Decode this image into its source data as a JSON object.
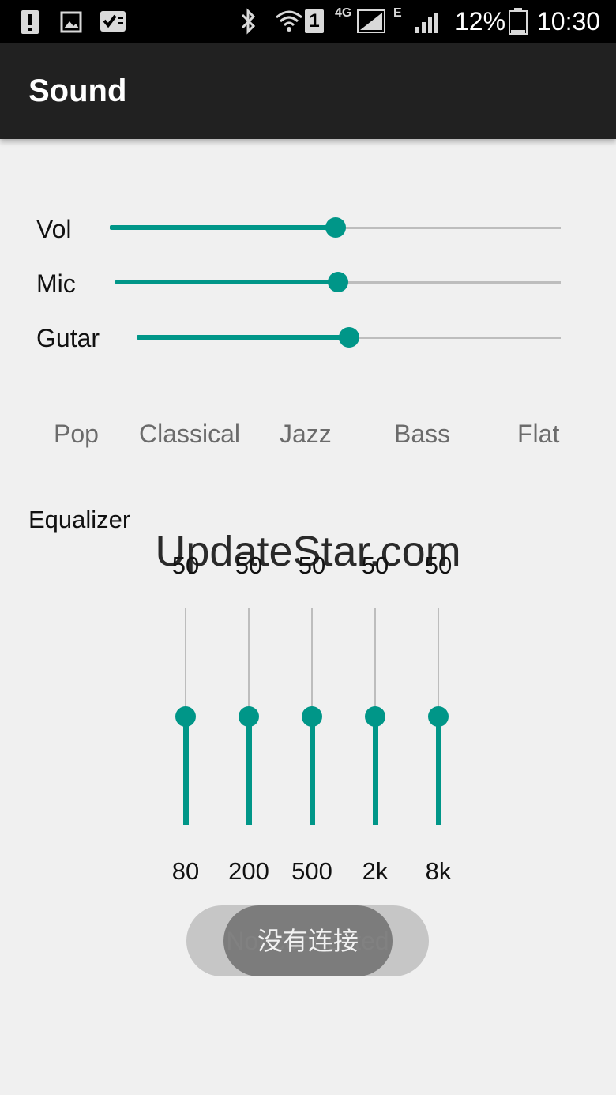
{
  "status_bar": {
    "battery": "12%",
    "time": "10:30",
    "network_4g": "4G",
    "network_e": "E",
    "sim_slot": "1",
    "icons": [
      "alert-icon",
      "image-icon",
      "checklist-icon",
      "bluetooth-icon",
      "wifi-icon",
      "signal-icon",
      "battery-icon"
    ]
  },
  "app_bar": {
    "title": "Sound"
  },
  "sliders": [
    {
      "label": "Vol",
      "value_fraction": 0.5
    },
    {
      "label": "Mic",
      "value_fraction": 0.5
    },
    {
      "label": "Gutar",
      "value_fraction": 0.5
    }
  ],
  "presets": [
    "Pop",
    "Classical",
    "Jazz",
    "Bass",
    "Flat"
  ],
  "equalizer": {
    "title": "Equalizer",
    "bands": [
      {
        "freq": "80",
        "value": "50"
      },
      {
        "freq": "200",
        "value": "50"
      },
      {
        "freq": "500",
        "value": "50"
      },
      {
        "freq": "2k",
        "value": "50"
      },
      {
        "freq": "8k",
        "value": "50"
      }
    ],
    "level_fraction": 0.5
  },
  "watermark": "UpdateStar.com",
  "toasts": {
    "back": "Not connected",
    "front": "没有连接"
  },
  "colors": {
    "accent": "#009688",
    "track": "#bdbdbd",
    "app_bar": "#212121",
    "background": "#f0f0f0"
  }
}
